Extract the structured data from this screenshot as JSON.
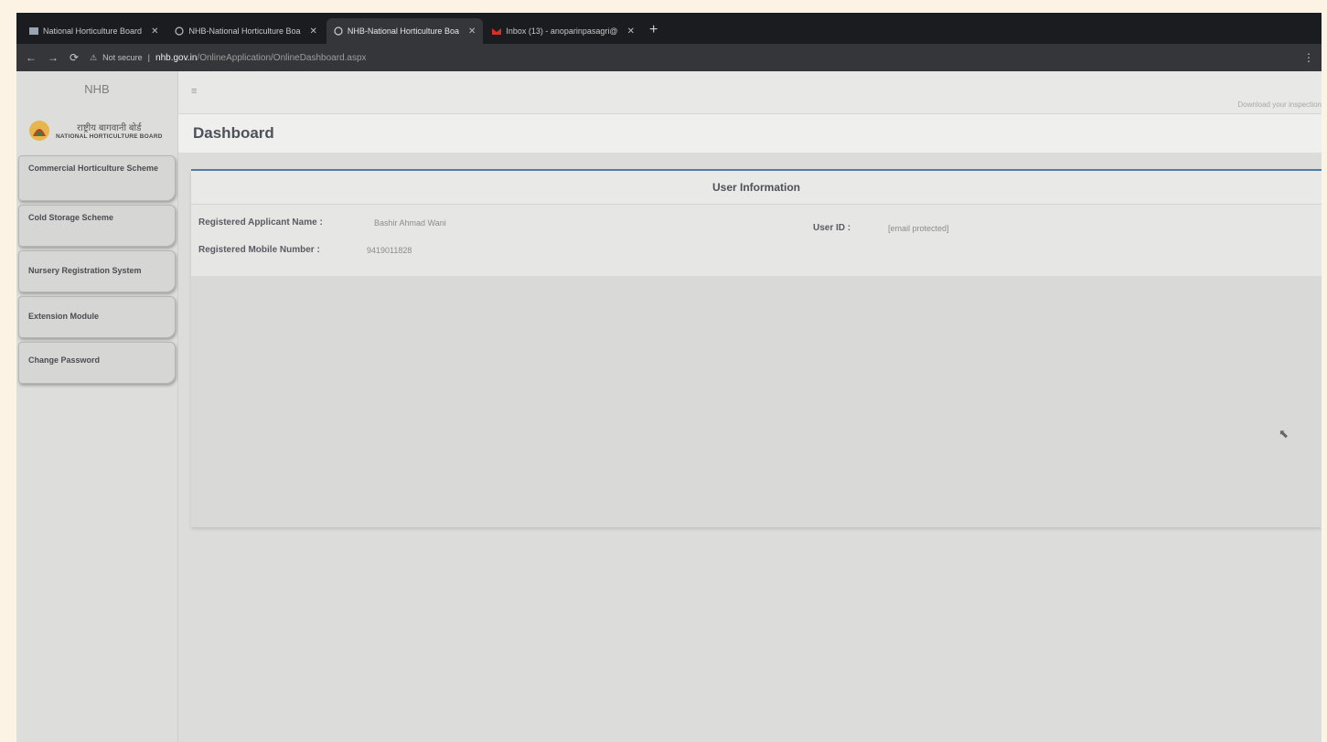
{
  "browser": {
    "tabs": [
      {
        "title": "National Horticulture Board",
        "active": false
      },
      {
        "title": "NHB-National Horticulture Boa",
        "active": false
      },
      {
        "title": "NHB-National Horticulture Boa",
        "active": true
      },
      {
        "title": "Inbox (13) - anoparinpasagri@",
        "active": false
      }
    ],
    "new_tab_label": "+",
    "not_secure_label": "Not secure",
    "url_host": "nhb.gov.in",
    "url_path": "/OnlineApplication/OnlineDashboard.aspx"
  },
  "sidebar": {
    "brand": "NHB",
    "logo_hindi": "राष्ट्रीय बागवानी बोर्ड",
    "logo_english": "NATIONAL HORTICULTURE BOARD",
    "items": [
      {
        "label": "Commercial Horticulture Scheme"
      },
      {
        "label": "Cold Storage Scheme"
      },
      {
        "label": "Nursery Registration System"
      },
      {
        "label": "Extension Module"
      },
      {
        "label": "Change Password"
      }
    ]
  },
  "header": {
    "menu_icon": "≡",
    "download_link": "Download your inspection",
    "page_title": "Dashboard"
  },
  "user_info": {
    "heading": "User Information",
    "name_label": "Registered Applicant Name :",
    "name_value": "Bashir Ahmad Wani",
    "mobile_label": "Registered Mobile Number :",
    "mobile_value": "9419011828",
    "userid_label": "User ID :",
    "userid_value": "[email protected]"
  },
  "colors": {
    "card_top_border": "#4d7ea8",
    "title_text": "#4f5059",
    "sidebar_bg": "#dddddc"
  }
}
